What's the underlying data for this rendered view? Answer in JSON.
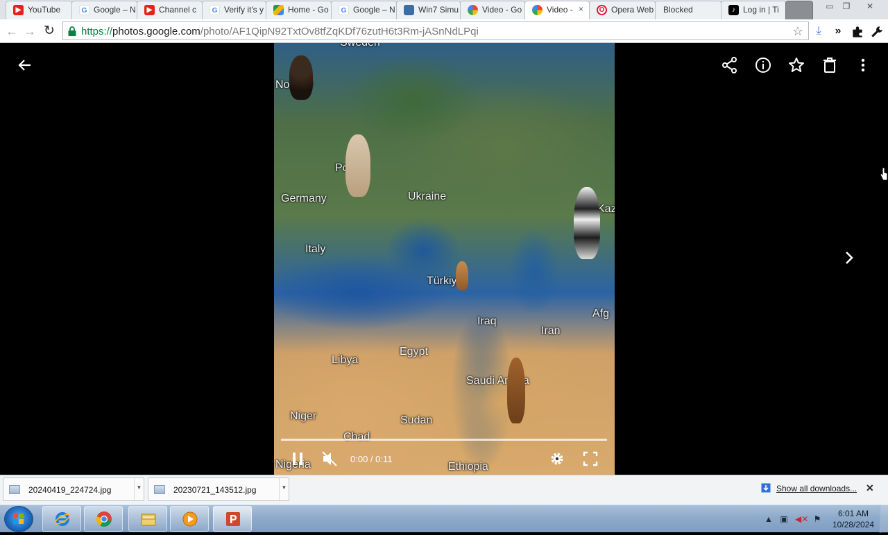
{
  "browser": {
    "tabs": [
      {
        "title": "YouTube",
        "favicon": "youtube-icon"
      },
      {
        "title": "Google – N",
        "favicon": "google-icon"
      },
      {
        "title": "Channel c",
        "favicon": "youtube-icon"
      },
      {
        "title": "Verify it's y",
        "favicon": "google-icon"
      },
      {
        "title": "Home - Go",
        "favicon": "google-drive-icon"
      },
      {
        "title": "Google – N",
        "favicon": "google-icon"
      },
      {
        "title": "Win7 Simu",
        "favicon": "windows-icon"
      },
      {
        "title": "Video - Go",
        "favicon": "google-photos-icon"
      },
      {
        "title": "Video - ",
        "favicon": "google-photos-icon",
        "active": true,
        "close": "×"
      },
      {
        "title": "Opera Web",
        "favicon": "opera-icon"
      },
      {
        "title": "Blocked",
        "favicon": ""
      },
      {
        "title": "Log in | Ti",
        "favicon": "tiktok-icon"
      }
    ],
    "url": {
      "scheme": "https://",
      "host": "photos.google.com",
      "path": "/photo/AF1QipN92TxtOv8tfZqKDf76zutH6t3Rm-jASnNdLPqi"
    }
  },
  "video": {
    "time": "0:00 / 0:11",
    "progress": 0.0,
    "places": [
      "Sweden",
      "Norway",
      "Poland",
      "Germany",
      "Ukraine",
      "Italy",
      "Türkiye",
      "Iraq",
      "Iran",
      "Afg",
      "Libya",
      "Egypt",
      "Saudi Arabia",
      "Niger",
      "Sudan",
      "Chad",
      "Ethiopia",
      "Nigeria",
      "Kaza"
    ]
  },
  "downloads": {
    "items": [
      {
        "name": "20240419_224724.jpg"
      },
      {
        "name": "20230721_143512.jpg"
      }
    ],
    "show_all": "Show all downloads..."
  },
  "taskbar": {
    "apps": [
      "internet-explorer-icon",
      "chrome-icon",
      "file-explorer-icon",
      "media-player-icon",
      "powerpoint-icon"
    ],
    "clock_time": "6:01 AM",
    "clock_date": "10/28/2024"
  },
  "colors": {
    "viewer_bg": "#000000",
    "taskbar": "#8eaacb",
    "url_secure": "#0b8043"
  }
}
